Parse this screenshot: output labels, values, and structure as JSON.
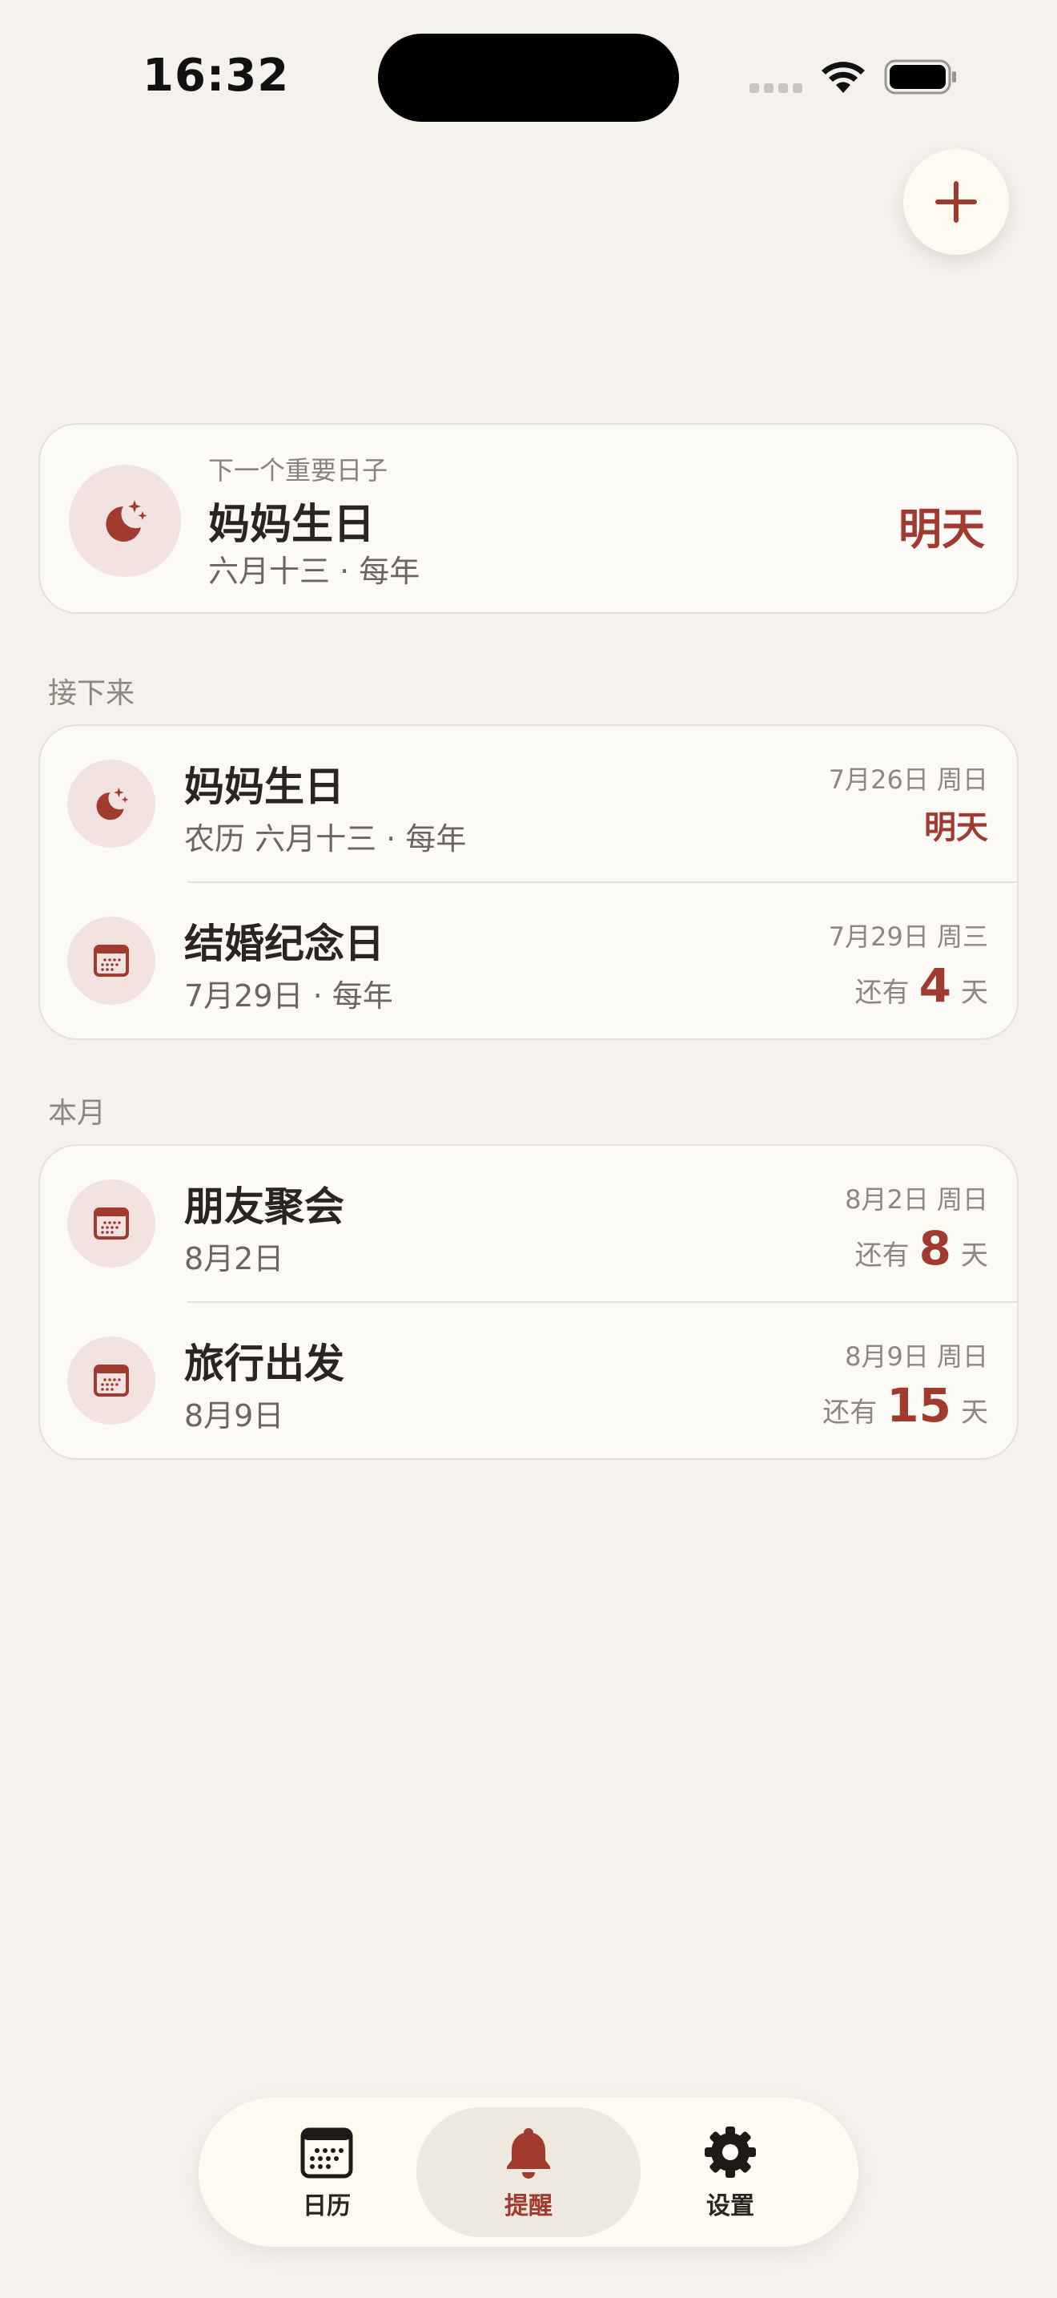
{
  "status_bar": {
    "time": "16:32"
  },
  "colors": {
    "accent": "#a23b2f",
    "background": "#f5f1ec",
    "card": "#fbfaf7",
    "icon_bg": "#f3e3e0"
  },
  "header": {
    "add_icon": "plus-icon"
  },
  "hero": {
    "eyebrow": "下一个重要日子",
    "title": "妈妈生日",
    "subtitle": "六月十三 · 每年",
    "badge": "明天",
    "icon": "moon-stars-icon"
  },
  "upcoming": {
    "label": "接下来",
    "items": [
      {
        "title": "妈妈生日",
        "subtitle": "农历 六月十三 · 每年",
        "date": "7月26日 周日",
        "status": "明天",
        "icon": "moon-stars-icon"
      },
      {
        "title": "结婚纪念日",
        "subtitle": "7月29日 · 每年",
        "date": "7月29日 周三",
        "pre": "还有",
        "days": "4",
        "post": "天",
        "icon": "calendar-icon"
      }
    ]
  },
  "this_month": {
    "label": "本月",
    "items": [
      {
        "title": "朋友聚会",
        "subtitle": "8月2日",
        "date": "8月2日 周日",
        "pre": "还有",
        "days": "8",
        "post": "天",
        "icon": "calendar-icon"
      },
      {
        "title": "旅行出发",
        "subtitle": "8月9日",
        "date": "8月9日 周日",
        "pre": "还有",
        "days": "15",
        "post": "天",
        "icon": "calendar-icon"
      }
    ]
  },
  "tabbar": {
    "tabs": [
      {
        "label": "日历",
        "icon": "calendar-icon",
        "active": false
      },
      {
        "label": "提醒",
        "icon": "bell-icon",
        "active": true
      },
      {
        "label": "设置",
        "icon": "gear-icon",
        "active": false
      }
    ]
  }
}
